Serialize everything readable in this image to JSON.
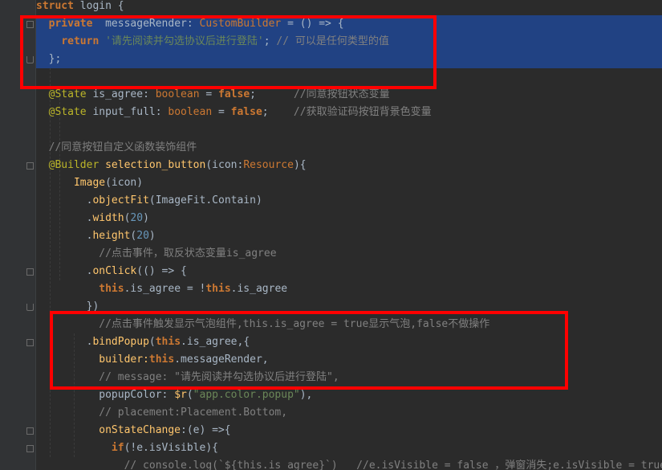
{
  "editor": {
    "lines": [
      [
        {
          "t": "struct",
          "c": "kw"
        },
        {
          "t": " login {",
          "c": "nm"
        }
      ],
      [
        {
          "t": "  ",
          "c": "nm"
        },
        {
          "t": "private",
          "c": "kw"
        },
        {
          "t": "  messageRender",
          "c": "nm"
        },
        {
          "t": ": ",
          "c": "pu"
        },
        {
          "t": "CustomBuilder",
          "c": "ty"
        },
        {
          "t": " = () => {",
          "c": "nm"
        }
      ],
      [
        {
          "t": "    ",
          "c": "nm"
        },
        {
          "t": "return",
          "c": "kw"
        },
        {
          "t": " ",
          "c": "nm"
        },
        {
          "t": "'请先阅读并勾选协议后进行登陆'",
          "c": "str"
        },
        {
          "t": "; ",
          "c": "pu"
        },
        {
          "t": "// 可以是任何类型的值",
          "c": "cm"
        }
      ],
      [
        {
          "t": "  };",
          "c": "nm"
        }
      ],
      [],
      [
        {
          "t": "  ",
          "c": "nm"
        },
        {
          "t": "@State",
          "c": "an"
        },
        {
          "t": " is_agree",
          "c": "nm"
        },
        {
          "t": ": ",
          "c": "pu"
        },
        {
          "t": "boolean",
          "c": "kwl"
        },
        {
          "t": " = ",
          "c": "nm"
        },
        {
          "t": "false",
          "c": "kw"
        },
        {
          "t": ";",
          "c": "pu"
        },
        {
          "t": "      //同意按钮状态变量",
          "c": "cm"
        }
      ],
      [
        {
          "t": "  ",
          "c": "nm"
        },
        {
          "t": "@State",
          "c": "an"
        },
        {
          "t": " input_full",
          "c": "nm"
        },
        {
          "t": ": ",
          "c": "pu"
        },
        {
          "t": "boolean",
          "c": "kwl"
        },
        {
          "t": " = ",
          "c": "nm"
        },
        {
          "t": "false",
          "c": "kw"
        },
        {
          "t": ";",
          "c": "pu"
        },
        {
          "t": "    //获取验证码按钮背景色变量",
          "c": "cm"
        }
      ],
      [],
      [
        {
          "t": "  //同意按钮自定义函数装饰组件",
          "c": "cm"
        }
      ],
      [
        {
          "t": "  ",
          "c": "nm"
        },
        {
          "t": "@Builder",
          "c": "an"
        },
        {
          "t": " selection_button",
          "c": "fn"
        },
        {
          "t": "(icon:",
          "c": "nm"
        },
        {
          "t": "Resource",
          "c": "ty"
        },
        {
          "t": "){",
          "c": "nm"
        }
      ],
      [
        {
          "t": "      ",
          "c": "nm"
        },
        {
          "t": "Image",
          "c": "fn"
        },
        {
          "t": "(icon)",
          "c": "nm"
        }
      ],
      [
        {
          "t": "        .",
          "c": "nm"
        },
        {
          "t": "objectFit",
          "c": "fn"
        },
        {
          "t": "(ImageFit.Contain)",
          "c": "nm"
        }
      ],
      [
        {
          "t": "        .",
          "c": "nm"
        },
        {
          "t": "width",
          "c": "fn"
        },
        {
          "t": "(",
          "c": "nm"
        },
        {
          "t": "20",
          "c": "num"
        },
        {
          "t": ")",
          "c": "nm"
        }
      ],
      [
        {
          "t": "        .",
          "c": "nm"
        },
        {
          "t": "height",
          "c": "fn"
        },
        {
          "t": "(",
          "c": "nm"
        },
        {
          "t": "20",
          "c": "num"
        },
        {
          "t": ")",
          "c": "nm"
        }
      ],
      [
        {
          "t": "          //点击事件，取反状态变量is_agree",
          "c": "cm"
        }
      ],
      [
        {
          "t": "        .",
          "c": "nm"
        },
        {
          "t": "onClick",
          "c": "fn"
        },
        {
          "t": "(() => {",
          "c": "nm"
        }
      ],
      [
        {
          "t": "          ",
          "c": "nm"
        },
        {
          "t": "this",
          "c": "kw"
        },
        {
          "t": ".is_agree = !",
          "c": "nm"
        },
        {
          "t": "this",
          "c": "kw"
        },
        {
          "t": ".is_agree",
          "c": "nm"
        }
      ],
      [
        {
          "t": "        })",
          "c": "nm"
        }
      ],
      [
        {
          "t": "          //点击事件触发显示气泡组件,this.is_agree = true显示气泡,false不做操作",
          "c": "cm"
        }
      ],
      [
        {
          "t": "        .",
          "c": "nm"
        },
        {
          "t": "bindPopup",
          "c": "fn"
        },
        {
          "t": "(",
          "c": "nm"
        },
        {
          "t": "this",
          "c": "kw"
        },
        {
          "t": ".is_agree,{",
          "c": "nm"
        }
      ],
      [
        {
          "t": "          builder:",
          "c": "fn"
        },
        {
          "t": "this",
          "c": "kw"
        },
        {
          "t": ".messageRender,",
          "c": "nm"
        }
      ],
      [
        {
          "t": "          // message: \"请先阅读并勾选协议后进行登陆\",",
          "c": "cm"
        }
      ],
      [
        {
          "t": "          popupColor: ",
          "c": "nm"
        },
        {
          "t": "$r",
          "c": "fn"
        },
        {
          "t": "(",
          "c": "nm"
        },
        {
          "t": "\"app.color.popup\"",
          "c": "str"
        },
        {
          "t": "),",
          "c": "nm"
        }
      ],
      [
        {
          "t": "          // placement:Placement.Bottom,",
          "c": "cm"
        }
      ],
      [
        {
          "t": "          onStateChange",
          "c": "fn"
        },
        {
          "t": ":(e) =>{",
          "c": "nm"
        }
      ],
      [
        {
          "t": "            ",
          "c": "nm"
        },
        {
          "t": "if",
          "c": "kw"
        },
        {
          "t": "(!e.isVisible){",
          "c": "nm"
        }
      ],
      [
        {
          "t": "              // console.log(`${this.is_agree}`)   //e.isVisible = false ，弹窗消失;e.isVisible = true",
          "c": "cm"
        }
      ]
    ]
  }
}
